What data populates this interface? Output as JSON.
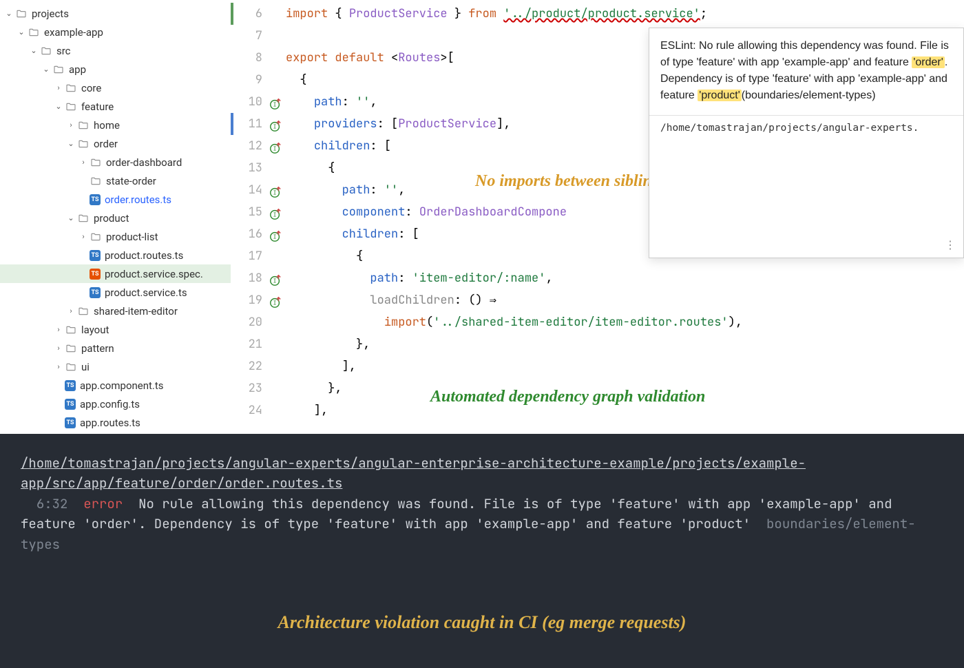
{
  "sidebar": {
    "items": [
      {
        "name": "projects",
        "type": "folder",
        "indent": 0,
        "chev": "down"
      },
      {
        "name": "example-app",
        "type": "folder",
        "indent": 1,
        "chev": "down"
      },
      {
        "name": "src",
        "type": "folder",
        "indent": 2,
        "chev": "down"
      },
      {
        "name": "app",
        "type": "folder",
        "indent": 3,
        "chev": "down"
      },
      {
        "name": "core",
        "type": "folder",
        "indent": 4,
        "chev": "right"
      },
      {
        "name": "feature",
        "type": "folder",
        "indent": 4,
        "chev": "down"
      },
      {
        "name": "home",
        "type": "folder",
        "indent": 5,
        "chev": "right"
      },
      {
        "name": "order",
        "type": "folder",
        "indent": 5,
        "chev": "down"
      },
      {
        "name": "order-dashboard",
        "type": "folder",
        "indent": 6,
        "chev": "right"
      },
      {
        "name": "state-order",
        "type": "folder",
        "indent": 6,
        "chev": ""
      },
      {
        "name": "order.routes.ts",
        "type": "ts",
        "indent": 6,
        "chev": "",
        "active": true
      },
      {
        "name": "product",
        "type": "folder",
        "indent": 5,
        "chev": "down"
      },
      {
        "name": "product-list",
        "type": "folder",
        "indent": 6,
        "chev": "right"
      },
      {
        "name": "product.routes.ts",
        "type": "ts",
        "indent": 6,
        "chev": ""
      },
      {
        "name": "product.service.spec.",
        "type": "spec",
        "indent": 6,
        "chev": "",
        "sel": true
      },
      {
        "name": "product.service.ts",
        "type": "ts",
        "indent": 6,
        "chev": ""
      },
      {
        "name": "shared-item-editor",
        "type": "folder",
        "indent": 5,
        "chev": "right"
      },
      {
        "name": "layout",
        "type": "folder",
        "indent": 4,
        "chev": "right"
      },
      {
        "name": "pattern",
        "type": "folder",
        "indent": 4,
        "chev": "right"
      },
      {
        "name": "ui",
        "type": "folder",
        "indent": 4,
        "chev": "right"
      },
      {
        "name": "app.component.ts",
        "type": "ts",
        "indent": 4,
        "chev": ""
      },
      {
        "name": "app.config.ts",
        "type": "ts",
        "indent": 4,
        "chev": ""
      },
      {
        "name": "app.routes.ts",
        "type": "ts",
        "indent": 4,
        "chev": ""
      }
    ]
  },
  "editor": {
    "lines": [
      {
        "n": 6,
        "seg": [
          [
            "kw",
            "import"
          ],
          [
            "",
            " { "
          ],
          [
            "id",
            "ProductService"
          ],
          [
            "",
            " } "
          ],
          [
            "kw",
            "from"
          ],
          [
            "",
            " "
          ],
          [
            "str err",
            "'../product/product.service'"
          ],
          [
            "",
            ";"
          ]
        ]
      },
      {
        "n": 7,
        "seg": []
      },
      {
        "n": 8,
        "seg": [
          [
            "kw",
            "export default"
          ],
          [
            "",
            " <"
          ],
          [
            "id",
            "Routes"
          ],
          [
            "",
            ">["
          ]
        ]
      },
      {
        "n": 9,
        "seg": [
          [
            "",
            "  {"
          ]
        ]
      },
      {
        "n": 10,
        "badge": true,
        "seg": [
          [
            "",
            "    "
          ],
          [
            "def",
            "path"
          ],
          [
            "",
            ": "
          ],
          [
            "str",
            "''"
          ],
          [
            "",
            ","
          ]
        ]
      },
      {
        "n": 11,
        "badge": true,
        "seg": [
          [
            "",
            "    "
          ],
          [
            "def",
            "providers"
          ],
          [
            "",
            ": ["
          ],
          [
            "id",
            "ProductService"
          ],
          [
            "",
            "],"
          ]
        ]
      },
      {
        "n": 12,
        "badge": true,
        "seg": [
          [
            "",
            "    "
          ],
          [
            "def",
            "children"
          ],
          [
            "",
            ": ["
          ]
        ]
      },
      {
        "n": 13,
        "seg": [
          [
            "",
            "      {"
          ]
        ]
      },
      {
        "n": 14,
        "badge": true,
        "seg": [
          [
            "",
            "        "
          ],
          [
            "def",
            "path"
          ],
          [
            "",
            ": "
          ],
          [
            "str",
            "''"
          ],
          [
            "",
            ","
          ]
        ]
      },
      {
        "n": 15,
        "badge": true,
        "seg": [
          [
            "",
            "        "
          ],
          [
            "def",
            "component"
          ],
          [
            "",
            ": "
          ],
          [
            "id",
            "OrderDashboardCompone"
          ]
        ]
      },
      {
        "n": 16,
        "badge": true,
        "seg": [
          [
            "",
            "        "
          ],
          [
            "def",
            "children"
          ],
          [
            "",
            ": ["
          ]
        ]
      },
      {
        "n": 17,
        "seg": [
          [
            "",
            "          {"
          ]
        ]
      },
      {
        "n": 18,
        "badge": true,
        "seg": [
          [
            "",
            "            "
          ],
          [
            "def",
            "path"
          ],
          [
            "",
            ": "
          ],
          [
            "str",
            "'item-editor/:name'"
          ],
          [
            "",
            ","
          ]
        ]
      },
      {
        "n": 19,
        "badge": true,
        "seg": [
          [
            "",
            "            "
          ],
          [
            "grey",
            "loadChildren"
          ],
          [
            "",
            ": () ⇒"
          ]
        ]
      },
      {
        "n": 20,
        "seg": [
          [
            "",
            "              "
          ],
          [
            "kw",
            "import"
          ],
          [
            "",
            "("
          ],
          [
            "str",
            "'../shared-item-editor/item-editor.routes'"
          ],
          [
            "",
            "),"
          ]
        ]
      },
      {
        "n": 21,
        "seg": [
          [
            "",
            "          },"
          ]
        ]
      },
      {
        "n": 22,
        "seg": [
          [
            "",
            "        ],"
          ]
        ]
      },
      {
        "n": 23,
        "seg": [
          [
            "",
            "      },"
          ]
        ]
      },
      {
        "n": 24,
        "seg": [
          [
            "",
            "    ],"
          ]
        ]
      }
    ]
  },
  "tooltip": {
    "prefix": "ESLint: No rule allowing this dependency was found. File is of type 'feature' with app 'example-app' and feature ",
    "hl1": "'order'",
    "mid": ". Dependency is of type 'feature' with app 'example-app' and feature ",
    "hl2": "'product'",
    "suffix": "(boundaries/element-types)",
    "path": "/home/tomastrajan/projects/angular-experts."
  },
  "annotations": {
    "a1": "No imports between sibling features!",
    "a2": "Automated dependency graph validation",
    "a3": "Architecture violation caught in CI (eg merge requests)"
  },
  "terminal": {
    "file": "/home/tomastrajan/projects/angular-experts/angular-enterprise-architecture-example/projects/example-app/src/app/feature/order/order.routes.ts",
    "pos": "6:32",
    "level": "error",
    "msg": "No rule allowing this dependency was found. File is of type 'feature' with app 'example-app' and feature 'order'. Dependency is of type 'feature' with app 'example-app' and feature 'product'",
    "rule": "boundaries/element-types"
  }
}
